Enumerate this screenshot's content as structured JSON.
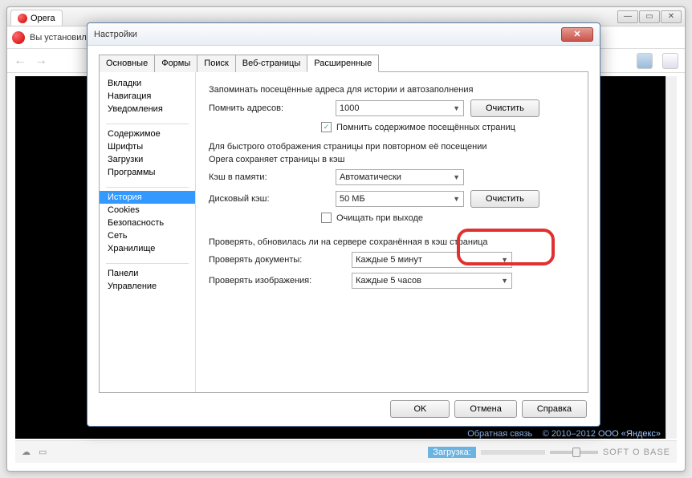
{
  "browser": {
    "tab_title": "Opera",
    "addr_text": "Вы установил",
    "statusbar_load": "Загрузка:",
    "watermark": "SOFT O BASE",
    "yandex_feedback": "Обратная связь",
    "yandex_copy": "© 2010–2012  ООО «Яндекс»"
  },
  "dialog": {
    "title": "Настройки",
    "tabs": [
      "Основные",
      "Формы",
      "Поиск",
      "Веб-страницы",
      "Расширенные"
    ],
    "active_tab": 4,
    "side_groups": [
      [
        "Вкладки",
        "Навигация",
        "Уведомления"
      ],
      [
        "Содержимое",
        "Шрифты",
        "Загрузки",
        "Программы"
      ],
      [
        "История",
        "Cookies",
        "Безопасность",
        "Сеть",
        "Хранилище"
      ],
      [
        "Панели",
        "Управление"
      ]
    ],
    "selected_side": "История",
    "pane": {
      "remember_text": "Запоминать посещённые адреса для истории и автозаполнения",
      "remember_label": "Помнить адресов:",
      "remember_value": "1000",
      "clear1": "Очистить",
      "remember_content_cb": "Помнить содержимое посещённых страниц",
      "cache_desc1": "Для быстрого отображения страницы при повторном её посещении",
      "cache_desc2": "Opera сохраняет страницы в кэш",
      "mem_cache_label": "Кэш в памяти:",
      "mem_cache_value": "Автоматически",
      "disk_cache_label": "Дисковый кэш:",
      "disk_cache_value": "50 МБ",
      "clear2": "Очистить",
      "clear_on_exit": "Очищать при выходе",
      "check_text": "Проверять, обновилась ли на сервере сохранённая в кэш страница",
      "check_docs_label": "Проверять документы:",
      "check_docs_value": "Каждые 5 минут",
      "check_imgs_label": "Проверять изображения:",
      "check_imgs_value": "Каждые 5 часов"
    },
    "footer": {
      "ok": "OK",
      "cancel": "Отмена",
      "help": "Справка"
    }
  }
}
